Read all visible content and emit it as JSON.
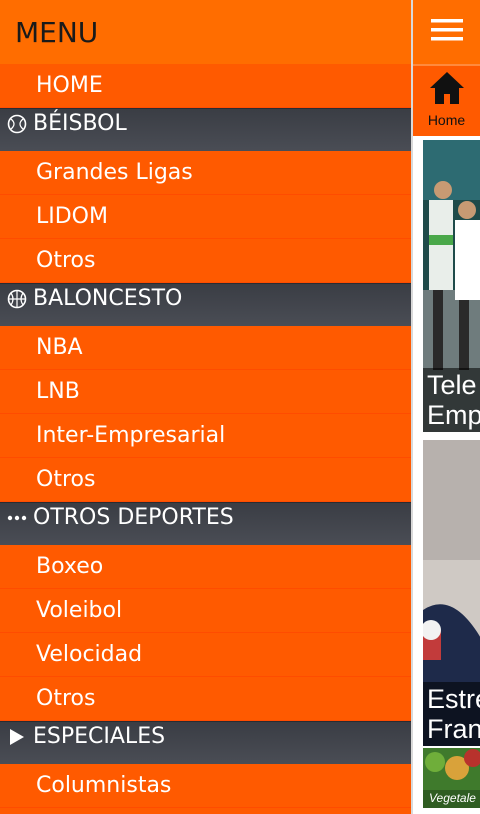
{
  "menu": {
    "title": "MENU",
    "items": [
      {
        "type": "item",
        "label": "HOME"
      },
      {
        "type": "section",
        "label": "BÉISBOL",
        "icon": "baseball-icon"
      },
      {
        "type": "item",
        "label": "Grandes Ligas"
      },
      {
        "type": "item",
        "label": "LIDOM"
      },
      {
        "type": "item",
        "label": "Otros"
      },
      {
        "type": "section",
        "label": "BALONCESTO",
        "icon": "basketball-icon"
      },
      {
        "type": "item",
        "label": "NBA"
      },
      {
        "type": "item",
        "label": "LNB"
      },
      {
        "type": "item",
        "label": "Inter-Empresarial"
      },
      {
        "type": "item",
        "label": "Otros"
      },
      {
        "type": "section",
        "label": "OTROS DEPORTES",
        "icon": "ellipsis-icon"
      },
      {
        "type": "item",
        "label": "Boxeo"
      },
      {
        "type": "item",
        "label": "Voleibol"
      },
      {
        "type": "item",
        "label": "Velocidad"
      },
      {
        "type": "item",
        "label": "Otros"
      },
      {
        "type": "section",
        "label": "ESPECIALES",
        "icon": "play-triangle-icon"
      },
      {
        "type": "item",
        "label": "Columnistas"
      }
    ]
  },
  "strip": {
    "hamburger_icon": "hamburger-icon",
    "home_icon": "home-icon",
    "home_label": "Home",
    "cards": [
      {
        "caption_line1": "Tele",
        "caption_line2": "Emp"
      },
      {
        "caption_line1": "Estre",
        "caption_line2": "Fran"
      },
      {
        "caption_line1": "Vegetale"
      }
    ]
  },
  "colors": {
    "menu_orange": "#ff5a00",
    "header_orange": "#ff6d00",
    "section_dark": "#3e4148",
    "text": "#ffffff"
  }
}
